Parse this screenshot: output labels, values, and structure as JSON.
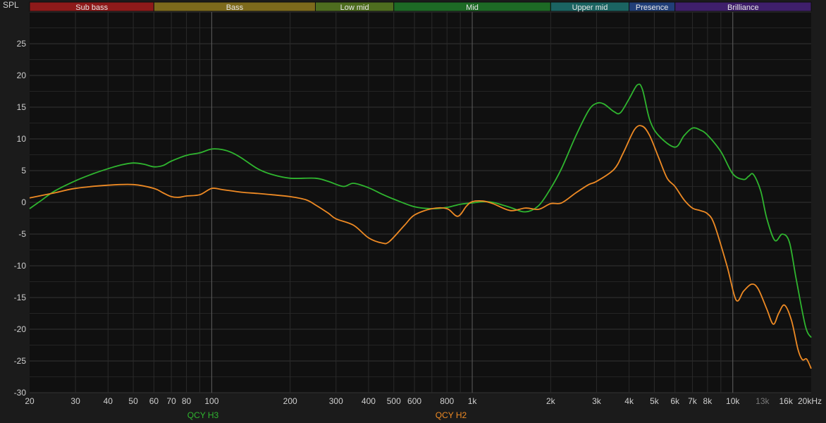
{
  "chart_data": {
    "type": "line",
    "ylabel": "SPL",
    "xscale": "log",
    "xlim": [
      20,
      20000
    ],
    "ylim": [
      -30,
      30
    ],
    "grid": true,
    "legend_position": "bottom",
    "y_ticks": [
      {
        "value": 25,
        "label": "25"
      },
      {
        "value": 20,
        "label": "20"
      },
      {
        "value": 15,
        "label": "15"
      },
      {
        "value": 10,
        "label": "10"
      },
      {
        "value": 5,
        "label": "5"
      },
      {
        "value": 0,
        "label": "0"
      },
      {
        "value": -5,
        "label": "-5"
      },
      {
        "value": -10,
        "label": "-10"
      },
      {
        "value": -15,
        "label": "-15"
      },
      {
        "value": -20,
        "label": "-20"
      },
      {
        "value": -25,
        "label": "-25"
      },
      {
        "value": -30,
        "label": "-30"
      }
    ],
    "x_ticks": [
      {
        "value": 20,
        "label": "20",
        "dim": false
      },
      {
        "value": 30,
        "label": "30",
        "dim": false
      },
      {
        "value": 40,
        "label": "40",
        "dim": false
      },
      {
        "value": 50,
        "label": "50",
        "dim": false
      },
      {
        "value": 60,
        "label": "60",
        "dim": false
      },
      {
        "value": 70,
        "label": "70",
        "dim": false
      },
      {
        "value": 80,
        "label": "80",
        "dim": false
      },
      {
        "value": 100,
        "label": "100",
        "dim": false
      },
      {
        "value": 200,
        "label": "200",
        "dim": false
      },
      {
        "value": 300,
        "label": "300",
        "dim": false
      },
      {
        "value": 400,
        "label": "400",
        "dim": false
      },
      {
        "value": 500,
        "label": "500",
        "dim": false
      },
      {
        "value": 600,
        "label": "600",
        "dim": false
      },
      {
        "value": 800,
        "label": "800",
        "dim": false
      },
      {
        "value": 1000,
        "label": "1k",
        "dim": false
      },
      {
        "value": 2000,
        "label": "2k",
        "dim": false
      },
      {
        "value": 3000,
        "label": "3k",
        "dim": false
      },
      {
        "value": 4000,
        "label": "4k",
        "dim": false
      },
      {
        "value": 5000,
        "label": "5k",
        "dim": false
      },
      {
        "value": 6000,
        "label": "6k",
        "dim": false
      },
      {
        "value": 7000,
        "label": "7k",
        "dim": false
      },
      {
        "value": 8000,
        "label": "8k",
        "dim": false
      },
      {
        "value": 10000,
        "label": "10k",
        "dim": false
      },
      {
        "value": 13000,
        "label": "13k",
        "dim": true
      },
      {
        "value": 16000,
        "label": "16k",
        "dim": false
      },
      {
        "value": 20000,
        "label": "20kHz",
        "dim": false
      }
    ],
    "major_lines": [
      100,
      1000,
      10000
    ],
    "bands": [
      {
        "label": "Sub bass",
        "from": 20,
        "to": 60,
        "color": "#8e1a1a"
      },
      {
        "label": "Bass",
        "from": 60,
        "to": 250,
        "color": "#7d6a1c"
      },
      {
        "label": "Low mid",
        "from": 250,
        "to": 500,
        "color": "#4e6d1f"
      },
      {
        "label": "Mid",
        "from": 500,
        "to": 2000,
        "color": "#1d6a25"
      },
      {
        "label": "Upper mid",
        "from": 2000,
        "to": 4000,
        "color": "#1b6462"
      },
      {
        "label": "Presence",
        "from": 4000,
        "to": 6000,
        "color": "#213f78"
      },
      {
        "label": "Brilliance",
        "from": 6000,
        "to": 20000,
        "color": "#3f1f6b"
      }
    ],
    "series": [
      {
        "name": "QCY H3",
        "color": "#2fb52f",
        "points": [
          [
            20,
            -1
          ],
          [
            22,
            0.2
          ],
          [
            25,
            1.8
          ],
          [
            30,
            3.4
          ],
          [
            35,
            4.5
          ],
          [
            40,
            5.3
          ],
          [
            45,
            5.9
          ],
          [
            50,
            6.2
          ],
          [
            55,
            6.0
          ],
          [
            60,
            5.6
          ],
          [
            65,
            5.8
          ],
          [
            70,
            6.5
          ],
          [
            80,
            7.4
          ],
          [
            90,
            7.8
          ],
          [
            100,
            8.4
          ],
          [
            110,
            8.3
          ],
          [
            120,
            7.8
          ],
          [
            130,
            7.0
          ],
          [
            150,
            5.3
          ],
          [
            170,
            4.4
          ],
          [
            200,
            3.8
          ],
          [
            250,
            3.8
          ],
          [
            280,
            3.3
          ],
          [
            320,
            2.5
          ],
          [
            350,
            3.0
          ],
          [
            400,
            2.3
          ],
          [
            450,
            1.3
          ],
          [
            500,
            0.5
          ],
          [
            600,
            -0.7
          ],
          [
            700,
            -1.0
          ],
          [
            800,
            -0.8
          ],
          [
            900,
            -0.3
          ],
          [
            1000,
            -0.1
          ],
          [
            1100,
            0.1
          ],
          [
            1200,
            0.0
          ],
          [
            1400,
            -0.8
          ],
          [
            1600,
            -1.5
          ],
          [
            1800,
            -0.5
          ],
          [
            2000,
            2.2
          ],
          [
            2200,
            5.3
          ],
          [
            2500,
            10.5
          ],
          [
            2800,
            14.5
          ],
          [
            3000,
            15.6
          ],
          [
            3200,
            15.5
          ],
          [
            3500,
            14.3
          ],
          [
            3700,
            14.1
          ],
          [
            4000,
            16.3
          ],
          [
            4300,
            18.5
          ],
          [
            4500,
            17.8
          ],
          [
            4800,
            13.0
          ],
          [
            5200,
            10.5
          ],
          [
            6000,
            8.7
          ],
          [
            6500,
            10.5
          ],
          [
            7000,
            11.7
          ],
          [
            7500,
            11.4
          ],
          [
            8000,
            10.6
          ],
          [
            9000,
            8.0
          ],
          [
            10000,
            4.5
          ],
          [
            11000,
            3.6
          ],
          [
            11500,
            4.1
          ],
          [
            12000,
            4.4
          ],
          [
            12800,
            1.8
          ],
          [
            13500,
            -2.5
          ],
          [
            14500,
            -6.0
          ],
          [
            15500,
            -5.0
          ],
          [
            16500,
            -6.3
          ],
          [
            17500,
            -12.0
          ],
          [
            19000,
            -19.5
          ],
          [
            20000,
            -21.3
          ]
        ]
      },
      {
        "name": "QCY H2",
        "color": "#ee8a24",
        "points": [
          [
            20,
            0.7
          ],
          [
            25,
            1.5
          ],
          [
            30,
            2.2
          ],
          [
            40,
            2.7
          ],
          [
            50,
            2.8
          ],
          [
            60,
            2.2
          ],
          [
            65,
            1.5
          ],
          [
            70,
            0.9
          ],
          [
            75,
            0.8
          ],
          [
            80,
            1.0
          ],
          [
            90,
            1.2
          ],
          [
            100,
            2.2
          ],
          [
            110,
            2.0
          ],
          [
            130,
            1.6
          ],
          [
            150,
            1.4
          ],
          [
            170,
            1.2
          ],
          [
            200,
            0.9
          ],
          [
            230,
            0.4
          ],
          [
            250,
            -0.4
          ],
          [
            280,
            -1.7
          ],
          [
            300,
            -2.6
          ],
          [
            350,
            -3.6
          ],
          [
            400,
            -5.6
          ],
          [
            450,
            -6.4
          ],
          [
            480,
            -6.2
          ],
          [
            550,
            -3.6
          ],
          [
            600,
            -2.0
          ],
          [
            700,
            -1.0
          ],
          [
            800,
            -1.0
          ],
          [
            880,
            -2.2
          ],
          [
            950,
            -0.6
          ],
          [
            1000,
            0.1
          ],
          [
            1100,
            0.2
          ],
          [
            1200,
            -0.2
          ],
          [
            1400,
            -1.3
          ],
          [
            1600,
            -0.9
          ],
          [
            1800,
            -1.1
          ],
          [
            2000,
            -0.2
          ],
          [
            2200,
            -0.1
          ],
          [
            2500,
            1.5
          ],
          [
            2800,
            2.8
          ],
          [
            3000,
            3.3
          ],
          [
            3500,
            5.2
          ],
          [
            3800,
            7.8
          ],
          [
            4200,
            11.5
          ],
          [
            4500,
            12.0
          ],
          [
            4800,
            10.5
          ],
          [
            5200,
            7.0
          ],
          [
            5600,
            3.8
          ],
          [
            6000,
            2.5
          ],
          [
            6500,
            0.4
          ],
          [
            7000,
            -0.9
          ],
          [
            7500,
            -1.3
          ],
          [
            8000,
            -1.8
          ],
          [
            8500,
            -3.5
          ],
          [
            9500,
            -10.0
          ],
          [
            10300,
            -15.4
          ],
          [
            11000,
            -14.0
          ],
          [
            11800,
            -12.9
          ],
          [
            12500,
            -13.6
          ],
          [
            13500,
            -16.8
          ],
          [
            14300,
            -19.2
          ],
          [
            15000,
            -17.5
          ],
          [
            15800,
            -16.2
          ],
          [
            16800,
            -18.6
          ],
          [
            17800,
            -23.2
          ],
          [
            18500,
            -24.8
          ],
          [
            19200,
            -24.7
          ],
          [
            20000,
            -26.2
          ]
        ]
      }
    ]
  }
}
